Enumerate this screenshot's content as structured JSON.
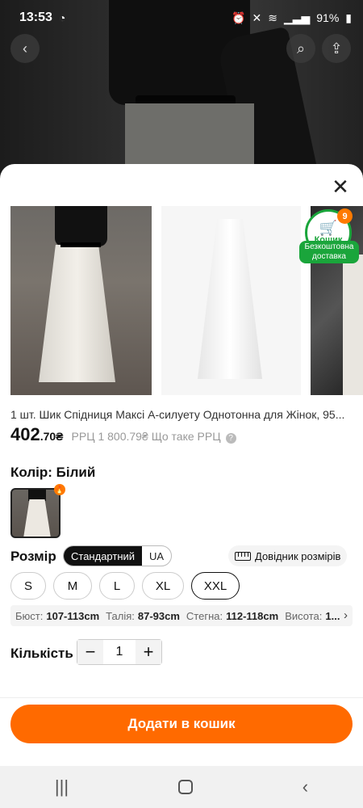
{
  "status_bar": {
    "time": "13:53",
    "battery": "91%"
  },
  "gallery_badge": {
    "cart_label": "Кошик",
    "cart_count": "9",
    "free_delivery": "Безкоштовна доставка"
  },
  "product": {
    "title": "1 шт. Шик Спідниця Максі А-силуету Однотонна для Жінок, 95...",
    "price_main": "402",
    "price_cents": ".70₴",
    "rrp": "РРЦ 1 800.79₴",
    "rrp_question": "Що таке РРЦ"
  },
  "color": {
    "label": "Колір: Білий"
  },
  "size": {
    "label": "Розмір",
    "standards": [
      "Стандартний",
      "UA"
    ],
    "guide_label": "Довідник розмірів",
    "options": [
      "S",
      "M",
      "L",
      "XL",
      "XXL"
    ],
    "selected": "XXL"
  },
  "measures": {
    "bust_label": "Бюст:",
    "bust_value": "107-113cm",
    "waist_label": "Талія:",
    "waist_value": "87-93cm",
    "hips_label": "Стегна:",
    "hips_value": "112-118cm",
    "height_label": "Висота:",
    "height_value": "1..."
  },
  "quantity": {
    "label": "Кількість",
    "value": "1",
    "minus": "−",
    "plus": "+"
  },
  "actions": {
    "add_to_cart": "Додати в кошик"
  },
  "colors": {
    "accent": "#ff6a00",
    "badge_green": "#1aa53b"
  }
}
